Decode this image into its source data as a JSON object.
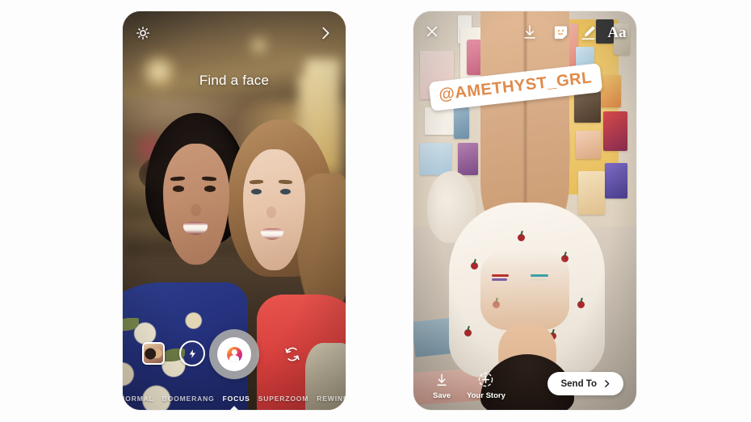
{
  "background_color": "#fdfdfd",
  "left_phone": {
    "name": "instagram-camera-focus-mode",
    "top_bar": {
      "settings_icon": "gear-icon",
      "next_icon": "chevron-right-icon"
    },
    "hint_text": "Find a face",
    "controls": {
      "gallery_icon": "gallery-thumbnail",
      "flash_icon": "flash-icon",
      "shutter_icon": "shutter-button",
      "flip_icon": "flip-camera-icon"
    },
    "modes": [
      {
        "label": "NORMAL",
        "active": false
      },
      {
        "label": "BOOMERANG",
        "active": false
      },
      {
        "label": "FOCUS",
        "active": true
      },
      {
        "label": "SUPERZOOM",
        "active": false
      },
      {
        "label": "REWIND",
        "active": false
      }
    ],
    "accent_color": "#ffffff"
  },
  "right_phone": {
    "name": "instagram-story-editor",
    "top_bar": {
      "close_icon": "close-icon",
      "download_icon": "download-icon",
      "sticker_icon": "sticker-smiley-icon",
      "draw_icon": "pen-draw-icon",
      "text_label": "Aa"
    },
    "mention_sticker": {
      "text": "@AMETHYST_GRL",
      "text_color": "#e08a4a",
      "background_color": "#ffffff"
    },
    "bottom_bar": {
      "save_label": "Save",
      "save_icon": "download-icon",
      "story_label": "Your Story",
      "story_icon": "add-circle-icon",
      "send_label": "Send To",
      "send_icon": "chevron-right-icon"
    }
  }
}
